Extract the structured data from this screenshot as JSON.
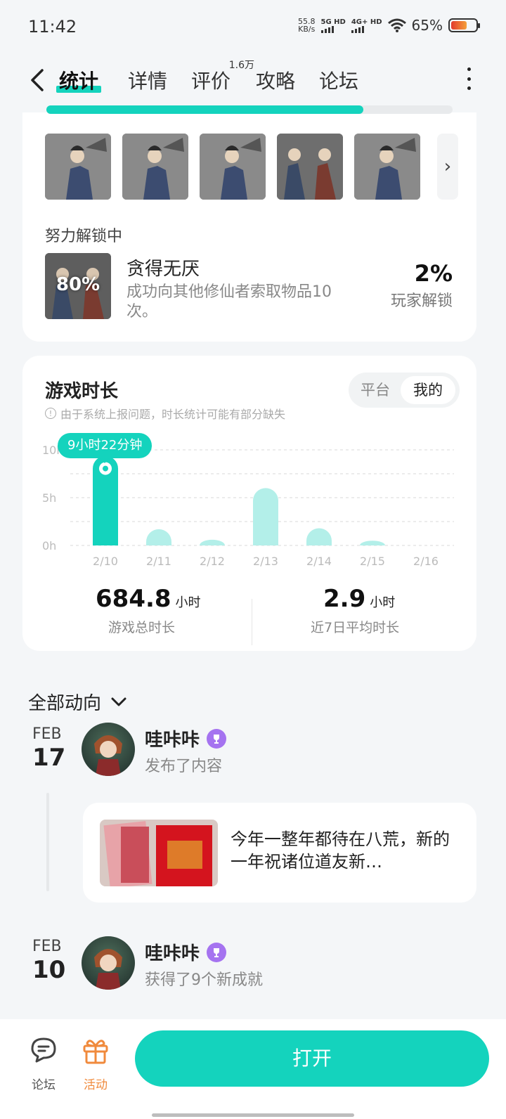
{
  "status_bar": {
    "time": "11:42",
    "net_speed_value": "55.8",
    "net_speed_unit": "KB/s",
    "signal1": "5G HD",
    "signal2": "4G+ HD",
    "battery_text": "65%",
    "battery_level": 0.65
  },
  "nav": {
    "tabs": [
      {
        "label": "统计"
      },
      {
        "label": "详情"
      },
      {
        "label": "评价",
        "count": "1.6万"
      },
      {
        "label": "攻略"
      },
      {
        "label": "论坛"
      }
    ],
    "active_tab": "统计"
  },
  "achievements": {
    "progress_fraction": 0.78,
    "section_label": "努力解锁中",
    "locked": {
      "progress": "80%",
      "title": "贪得无厌",
      "description": "成功向其他修仙者索取物品10次。",
      "rate": "2%",
      "rate_label": "玩家解锁"
    }
  },
  "playtime": {
    "title": "游戏时长",
    "note": "由于系统上报问题，时长统计可能有部分缺失",
    "toggle": {
      "option1": "平台",
      "option2": "我的",
      "selected": "我的"
    },
    "tooltip": "9小时22分钟",
    "total_value": "684.8",
    "total_unit": "小时",
    "total_label": "游戏总时长",
    "avg_value": "2.9",
    "avg_unit": "小时",
    "avg_label": "近7日平均时长"
  },
  "chart_data": {
    "type": "bar",
    "categories": [
      "2/10",
      "2/11",
      "2/12",
      "2/13",
      "2/14",
      "2/15",
      "2/16"
    ],
    "values": [
      9.37,
      1.7,
      0.6,
      6.0,
      1.8,
      0.5,
      0
    ],
    "selected_index": 0,
    "ylim": [
      0,
      10
    ],
    "yticks": [
      "0h",
      "5h",
      "10h"
    ],
    "grid": true,
    "colors": {
      "selected": "#14d3bd",
      "normal": "#b3efe9"
    }
  },
  "feed": {
    "header": "全部动向",
    "items": [
      {
        "month": "FEB",
        "day": "17",
        "user": "哇咔咔",
        "action": "发布了内容",
        "post_text": "今年一整年都待在八荒，新的一年祝诸位道友新…"
      },
      {
        "month": "FEB",
        "day": "10",
        "user": "哇咔咔",
        "action": "获得了9个新成就"
      }
    ]
  },
  "bottom_bar": {
    "forum_label": "论坛",
    "activity_label": "活动",
    "open_label": "打开"
  },
  "colors": {
    "accent": "#14d3bd",
    "activity": "#f08a3c",
    "badge": "#a573f0"
  }
}
